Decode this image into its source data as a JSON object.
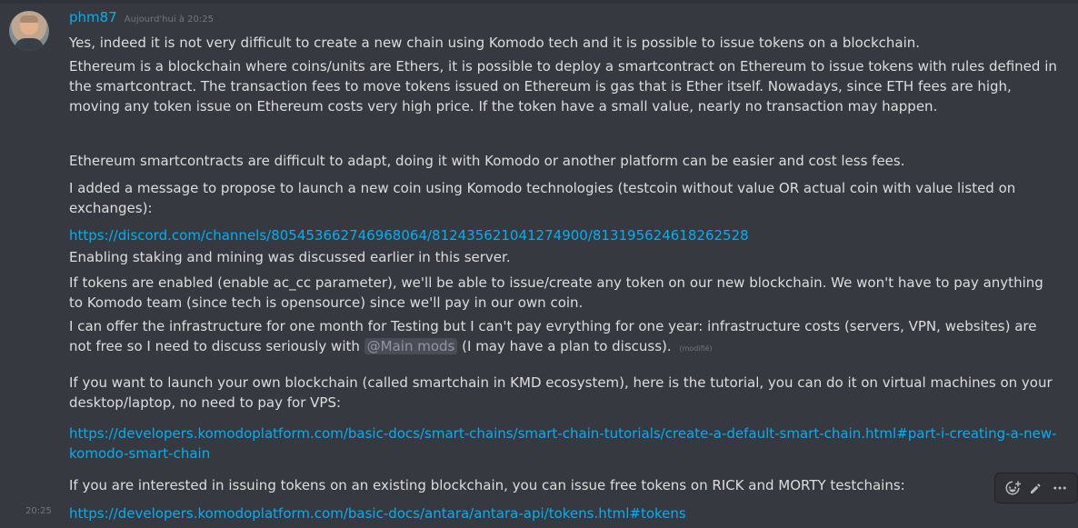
{
  "message": {
    "author": "phm87",
    "timestamp": "Aujourd'hui à 20:25",
    "hover_time": "20:25",
    "lines": [
      "Yes, indeed it is not very difficult to create a new chain using Komodo tech and it is possible to issue tokens on a blockchain.",
      "Ethereum is a blockchain where coins/units are Ethers, it is possible to deploy a smartcontract on Ethereum to issue tokens with rules defined in the smartcontract. The transaction fees to move tokens issued on Ethereum is gas that is Ether itself. Nowadays, since ETH fees are high, moving any token issue on Ethereum costs very high price. If the token have a small value, nearly no transaction may happen.",
      "Ethereum smartcontracts are difficult to adapt, doing it with Komodo or another platform can be easier and cost less fees.",
      "I added a message to propose to launch a new coin using Komodo technologies (testcoin without value OR actual coin with value listed on exchanges):",
      "Enabling staking and mining was discussed earlier in this server.",
      "If tokens are enabled (enable ac_cc parameter), we'll be able to issue/create any token on our new blockchain. We won't have to pay anything to Komodo team (since tech is opensource) since we'll pay in our own coin.",
      "I can offer the infrastructure for one month for Testing but I can't pay evrything for one year: infrastructure costs (servers, VPN, websites) are not free so I need to discuss seriously with",
      "(I may have a plan to discuss).",
      "If you want to launch your own blockchain (called smartchain in KMD ecosystem), here is the tutorial, you can do it on virtual machines on your desktop/laptop, no need to pay for VPS:",
      "If you are interested in issuing tokens on an existing blockchain, you can issue free tokens on RICK and MORTY testchains:"
    ],
    "links": [
      "https://discord.com/channels/805453662746968064/812435621041274900/813195624618262528",
      "https://developers.komodoplatform.com/basic-docs/smart-chains/smart-chain-tutorials/create-a-default-smart-chain.html#part-i-creating-a-new-komodo-smart-chain",
      "https://developers.komodoplatform.com/basic-docs/antara/antara-api/tokens.html#tokens"
    ],
    "mention": "@Main mods",
    "edited_label": "(modifié)"
  },
  "toolbar": {
    "icons": [
      "add-reaction-icon",
      "edit-icon",
      "more-icon"
    ]
  },
  "colors": {
    "background": "#36393f",
    "text": "#dcddde",
    "link": "#00b0f4",
    "muted": "#72767d"
  }
}
